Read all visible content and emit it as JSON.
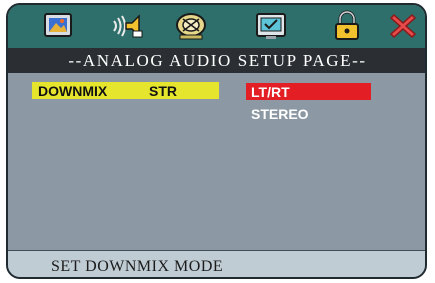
{
  "toolbar": {
    "icons": [
      {
        "name": "general-setup-icon"
      },
      {
        "name": "audio-setup-icon"
      },
      {
        "name": "dolby-setup-icon"
      },
      {
        "name": "video-setup-icon"
      },
      {
        "name": "password-lock-icon"
      },
      {
        "name": "exit-icon"
      }
    ]
  },
  "page": {
    "title": "--ANALOG AUDIO SETUP PAGE--"
  },
  "menu": {
    "item_label": "DOWNMIX",
    "item_value": "STR",
    "options": [
      "LT/RT",
      "STEREO"
    ],
    "selected_index": 0
  },
  "status": {
    "text": "SET DOWNMIX MODE"
  },
  "colors": {
    "icon_bar": "#2f6f6b",
    "title_bar": "#2b2f33",
    "content_bg": "#8c99a4",
    "highlight_item": "#e5e52d",
    "selected_option": "#e31e24",
    "status_bar": "#c0ccd4"
  }
}
